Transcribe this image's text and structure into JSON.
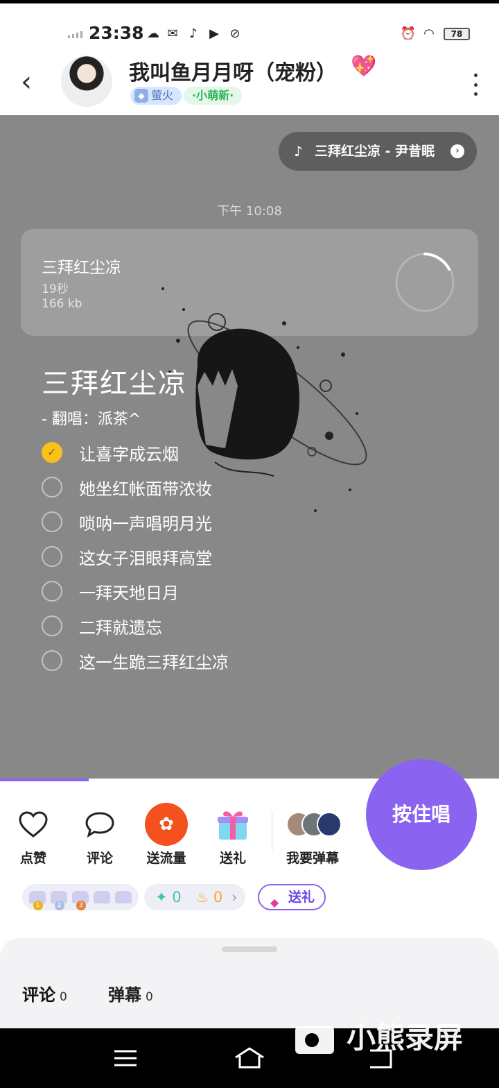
{
  "status_bar": {
    "time": "23:38",
    "battery": "78"
  },
  "header": {
    "back_icon": "chevron-left-icon",
    "title": "我叫鱼月月呀（宠粉）",
    "title_emoji": "💖",
    "badge_level": "萤火",
    "badge_new": "·小萌新·",
    "more_icon": "more-vertical-icon"
  },
  "main": {
    "music_pill": "三拜红尘凉 - 尹昔眠",
    "message_time": "下午 10:08",
    "audio": {
      "title": "三拜红尘凉",
      "duration": "19秒",
      "size": "166 kb"
    },
    "song_title": "三拜红尘凉",
    "cover_by": "-  翻唱：派茶^",
    "lyrics": [
      {
        "text": "让喜字成云烟",
        "checked": true
      },
      {
        "text": "她坐红帐面带浓妆",
        "checked": false
      },
      {
        "text": "唢呐一声唱明月光",
        "checked": false
      },
      {
        "text": "这女子泪眼拜高堂",
        "checked": false
      },
      {
        "text": "一拜天地日月",
        "checked": false
      },
      {
        "text": "二拜就遗忘",
        "checked": false
      },
      {
        "text": "这一生跪三拜红尘凉",
        "checked": false
      }
    ]
  },
  "actions": {
    "like": "点赞",
    "comment": "评论",
    "send_traffic": "送流量",
    "gift": "送礼",
    "danmaku": "我要弹幕",
    "sing": "按住唱"
  },
  "stats": {
    "stars": "0",
    "fire": "0",
    "gift_button": "送礼"
  },
  "tabs": {
    "comments_label": "评论",
    "comments_count": "0",
    "danmaku_label": "弹幕",
    "danmaku_count": "0"
  },
  "watermark": "小熊录屏",
  "colors": {
    "accent": "#8a63f0",
    "highlight": "#f7c21b",
    "traffic": "#f4511e"
  }
}
